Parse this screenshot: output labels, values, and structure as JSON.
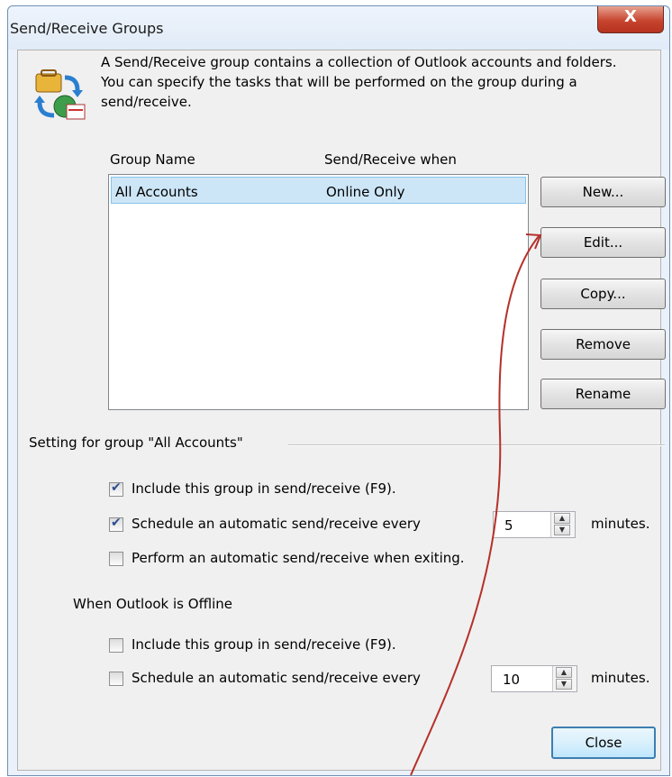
{
  "window": {
    "title": "Send/Receive Groups",
    "close_glyph": "X"
  },
  "description": "A Send/Receive group contains a collection of Outlook accounts and folders. You can specify the tasks that will be performed on the group during a send/receive.",
  "list": {
    "columns": [
      "Group Name",
      "Send/Receive when"
    ],
    "rows": [
      {
        "name": "All Accounts",
        "when": "Online Only",
        "selected": true
      }
    ]
  },
  "buttons": {
    "new": "New...",
    "edit": "Edit...",
    "copy": "Copy...",
    "remove": "Remove",
    "rename": "Rename"
  },
  "settings": {
    "group_title": "Setting for group \"All Accounts\"",
    "online": {
      "include_label": "Include this group in send/receive (F9).",
      "include_checked": true,
      "schedule_label": "Schedule an automatic send/receive every",
      "schedule_checked": true,
      "schedule_minutes": "5",
      "minutes_unit": "minutes.",
      "exit_label": "Perform an automatic send/receive when exiting.",
      "exit_checked": false
    },
    "offline_title": "When Outlook is Offline",
    "offline": {
      "include_label": "Include this group in send/receive (F9).",
      "include_checked": false,
      "schedule_label": "Schedule an automatic send/receive every",
      "schedule_checked": false,
      "schedule_minutes": "10",
      "minutes_unit": "minutes."
    }
  },
  "footer": {
    "close": "Close"
  },
  "icons": {
    "titlebar_close": "close-icon",
    "header": "send-receive-icon",
    "annotation": "red-arrow-annotation"
  },
  "colors": {
    "selection_bg": "#cde6f7",
    "close_red": "#c7452f",
    "annotation_red": "#b5302a"
  }
}
